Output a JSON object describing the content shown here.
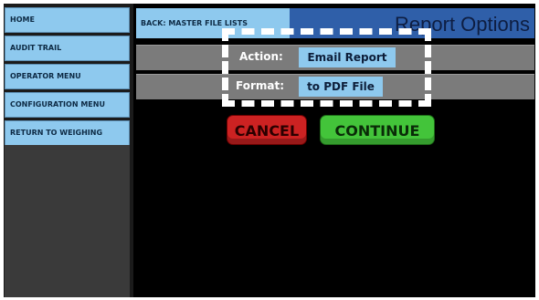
{
  "sidebar": {
    "items": [
      {
        "label": "HOME"
      },
      {
        "label": "AUDIT TRAIL"
      },
      {
        "label": "OPERATOR MENU"
      },
      {
        "label": "CONFIGURATION MENU"
      },
      {
        "label": "RETURN TO WEIGHING"
      }
    ]
  },
  "header": {
    "back_label": "BACK: MASTER FILE LISTS",
    "title": "Report Options"
  },
  "options": {
    "action_label": "Action:",
    "action_value": "Email Report",
    "format_label": "Format:",
    "format_value": "to PDF File"
  },
  "buttons": {
    "cancel": "CANCEL",
    "continue": "CONTINUE"
  },
  "colors": {
    "accent_blue": "#8ec9ee",
    "title_bar": "#2f5fa9",
    "cancel": "#cc2222",
    "continue": "#43c43a"
  }
}
